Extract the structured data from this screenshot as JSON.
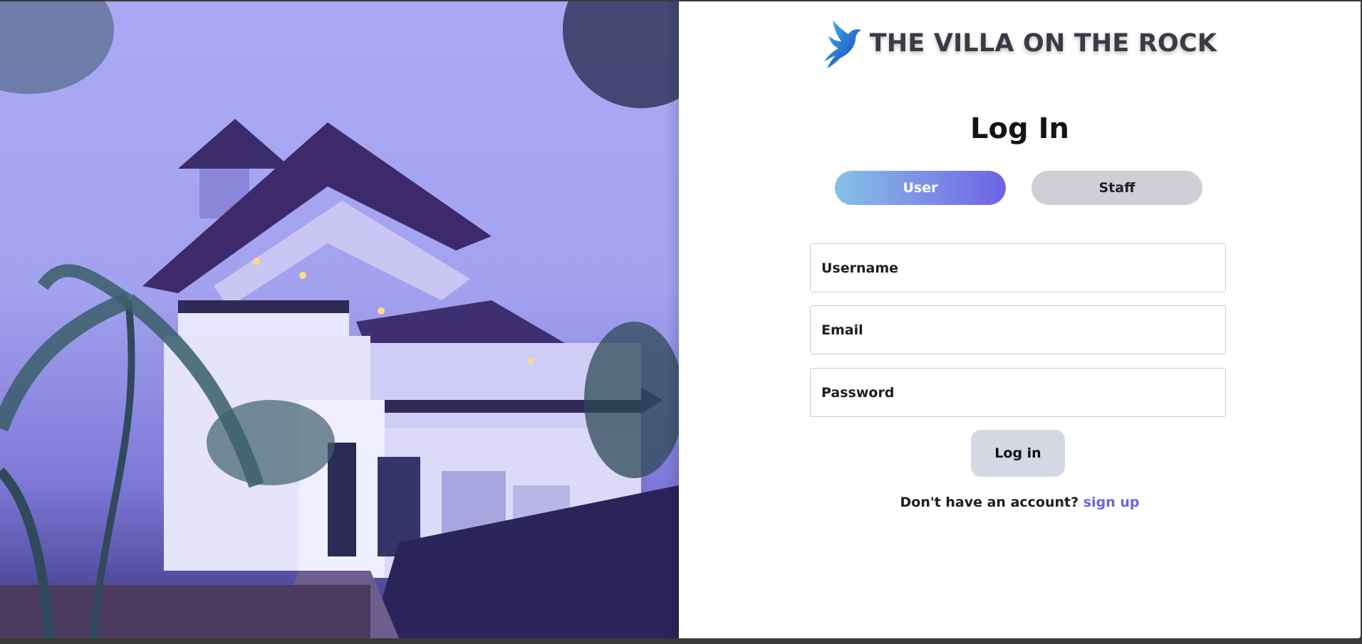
{
  "brand": {
    "name": "THE VILLA ON THE ROCK",
    "logo_icon": "bird-logo-icon"
  },
  "login": {
    "title": "Log In",
    "roles": [
      {
        "label": "User",
        "selected": true
      },
      {
        "label": "Staff",
        "selected": false
      }
    ],
    "fields": {
      "username_placeholder": "Username",
      "email_placeholder": "Email",
      "password_placeholder": "Password"
    },
    "submit_label": "Log in",
    "signup_prompt": "Don't have an account?",
    "signup_link": "sign up"
  },
  "colors": {
    "accent": "#6c63e6",
    "role_active_start": "#84c2e6",
    "role_active_end": "#6e62e4",
    "role_inactive": "#cfd0d5",
    "hero_tint": "#a3a2ef"
  }
}
